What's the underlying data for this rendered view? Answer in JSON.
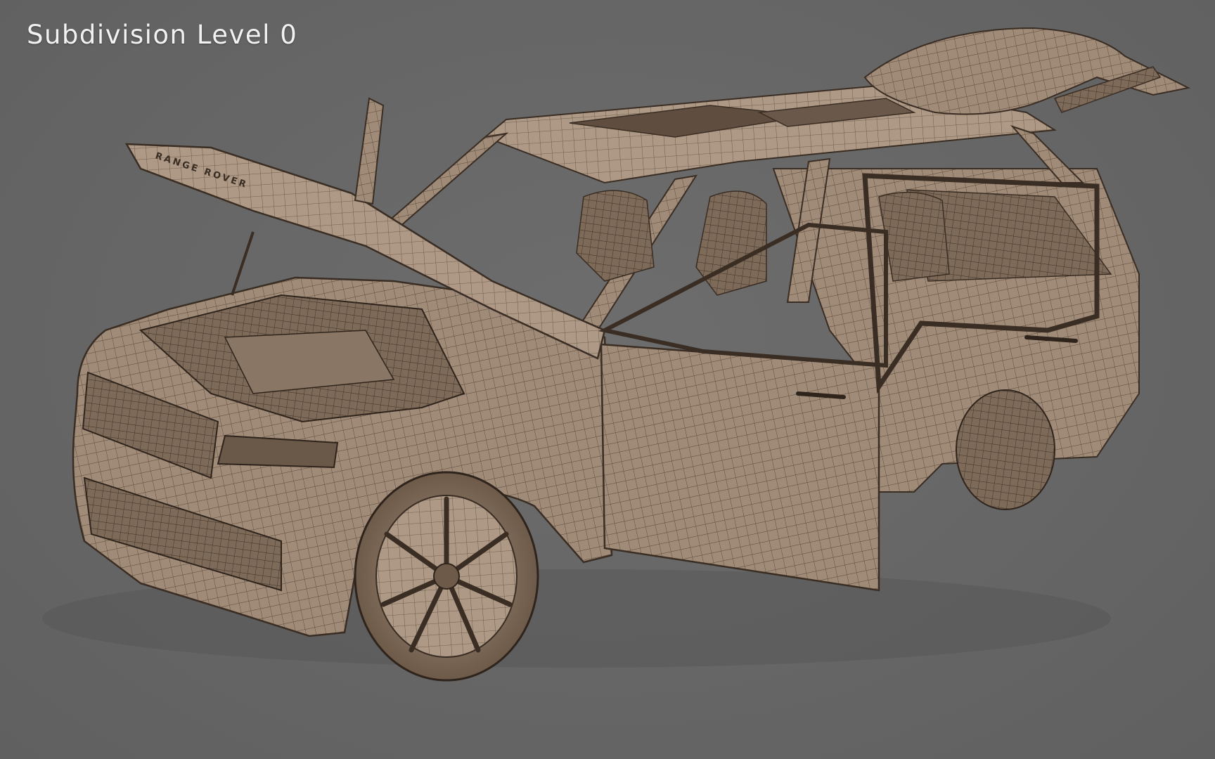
{
  "viewport": {
    "overlay_label": "Subdivision Level 0",
    "background_color": "#666666"
  },
  "model": {
    "subject": "suv-wireframe-render",
    "hood_lettering": "RANGE ROVER",
    "body_color": "#a08b78",
    "wire_color": "#4a3a2e"
  }
}
